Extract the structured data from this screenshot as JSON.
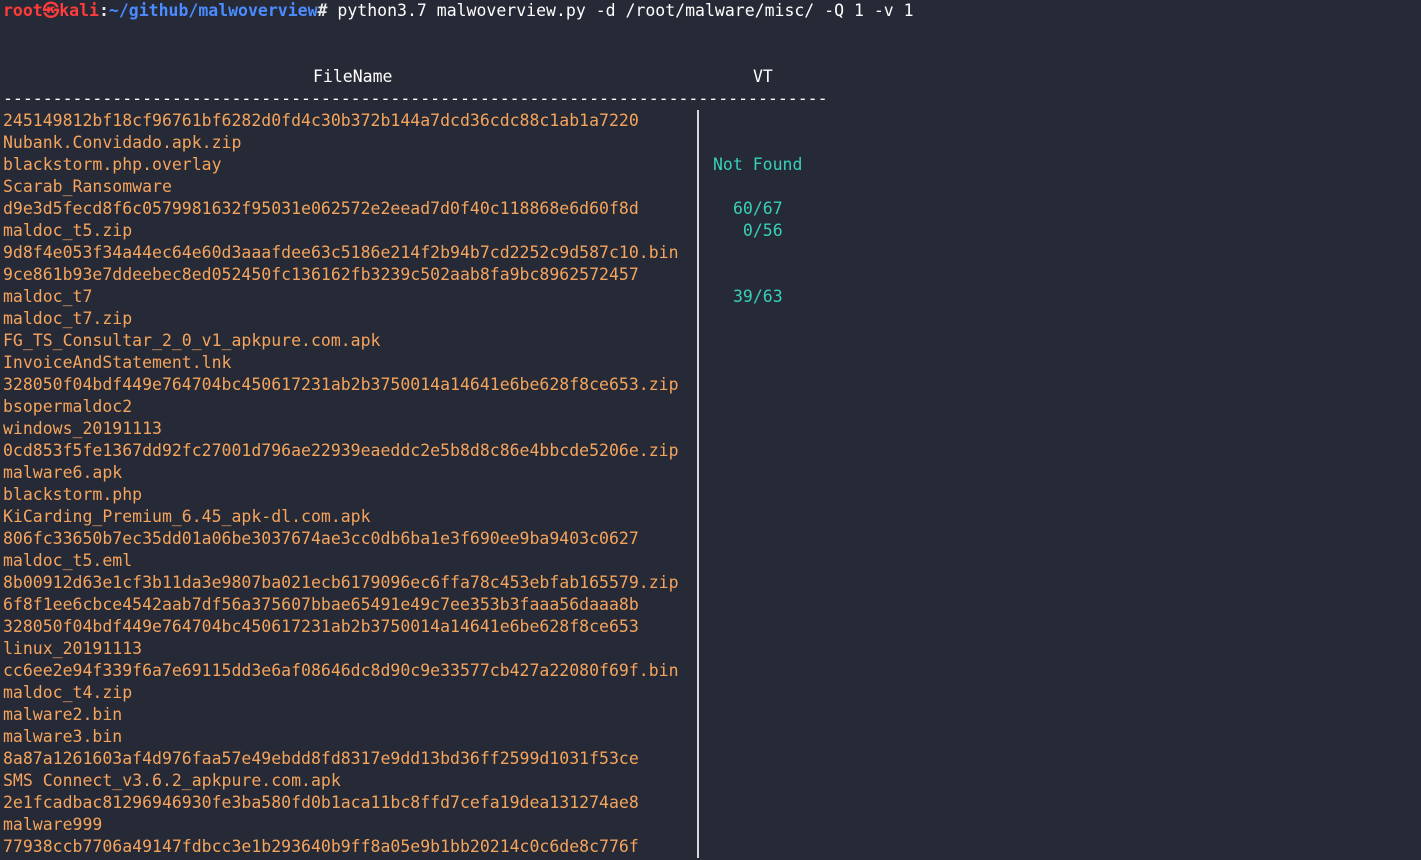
{
  "prompt": {
    "user": "root㉿kali",
    "colon": ":",
    "path": "~/github/malwoverview",
    "hash": "# ",
    "command": "python3.7 malwoverview.py -d /root/malware/misc/ -Q 1 -v 1"
  },
  "table": {
    "headers": {
      "filename": "FileName",
      "vt": "VT"
    },
    "separator": "-----------------------------------------------------------------------------------",
    "rows": [
      {
        "file": "245149812bf18cf96761bf6282d0fd4c30b372b144a7dcd36cdc88c1ab1a7220",
        "vt": ""
      },
      {
        "file": "Nubank.Convidado.apk.zip",
        "vt": ""
      },
      {
        "file": "blackstorm.php.overlay",
        "vt": "Not Found"
      },
      {
        "file": "Scarab_Ransomware",
        "vt": ""
      },
      {
        "file": "d9e3d5fecd8f6c0579981632f95031e062572e2eead7d0f40c118868e6d60f8d",
        "vt": "60/67"
      },
      {
        "file": "maldoc_t5.zip",
        "vt": " 0/56"
      },
      {
        "file": "9d8f4e053f34a44ec64e60d3aaafdee63c5186e214f2b94b7cd2252c9d587c10.bin",
        "vt": ""
      },
      {
        "file": "9ce861b93e7ddeebec8ed052450fc136162fb3239c502aab8fa9bc8962572457",
        "vt": ""
      },
      {
        "file": "maldoc_t7",
        "vt": "39/63"
      },
      {
        "file": "maldoc_t7.zip",
        "vt": ""
      },
      {
        "file": "FG_TS_Consultar_2_0_v1_apkpure.com.apk",
        "vt": ""
      },
      {
        "file": "InvoiceAndStatement.lnk",
        "vt": ""
      },
      {
        "file": "328050f04bdf449e764704bc450617231ab2b3750014a14641e6be628f8ce653.zip",
        "vt": ""
      },
      {
        "file": "bsopermaldoc2",
        "vt": ""
      },
      {
        "file": "windows_20191113",
        "vt": ""
      },
      {
        "file": "0cd853f5fe1367dd92fc27001d796ae22939eaeddc2e5b8d8c86e4bbcde5206e.zip",
        "vt": ""
      },
      {
        "file": "malware6.apk",
        "vt": ""
      },
      {
        "file": "blackstorm.php",
        "vt": ""
      },
      {
        "file": "KiCarding_Premium_6.45_apk-dl.com.apk",
        "vt": ""
      },
      {
        "file": "806fc33650b7ec35dd01a06be3037674ae3cc0db6ba1e3f690ee9ba9403c0627",
        "vt": ""
      },
      {
        "file": "maldoc_t5.eml",
        "vt": ""
      },
      {
        "file": "8b00912d63e1cf3b11da3e9807ba021ecb6179096ec6ffa78c453ebfab165579.zip",
        "vt": ""
      },
      {
        "file": "6f8f1ee6cbce4542aab7df56a375607bbae65491e49c7ee353b3faaa56daaa8b",
        "vt": ""
      },
      {
        "file": "328050f04bdf449e764704bc450617231ab2b3750014a14641e6be628f8ce653",
        "vt": ""
      },
      {
        "file": "linux_20191113",
        "vt": ""
      },
      {
        "file": "cc6ee2e94f339f6a7e69115dd3e6af08646dc8d90c9e33577cb427a22080f69f.bin",
        "vt": ""
      },
      {
        "file": "maldoc_t4.zip",
        "vt": ""
      },
      {
        "file": "malware2.bin",
        "vt": ""
      },
      {
        "file": "malware3.bin",
        "vt": ""
      },
      {
        "file": "8a87a1261603af4d976faa57e49ebdd8fd8317e9dd13bd36ff2599d1031f53ce",
        "vt": ""
      },
      {
        "file": "SMS Connect_v3.6.2_apkpure.com.apk",
        "vt": ""
      },
      {
        "file": "2e1fcadbac81296946930fe3ba580fd0b1aca11bc8ffd7cefa19dea131274ae8",
        "vt": ""
      },
      {
        "file": "malware999",
        "vt": ""
      },
      {
        "file": "77938ccb7706a49147fdbcc3e1b293640b9ff8a05e9b1bb20214c0c6de8c776f",
        "vt": ""
      }
    ]
  },
  "colors": {
    "background": "#262a36",
    "filename": "#f5a45d",
    "vt_result": "#37d0b8",
    "prompt_user": "#ff3b3b",
    "prompt_path": "#4a8cff"
  }
}
